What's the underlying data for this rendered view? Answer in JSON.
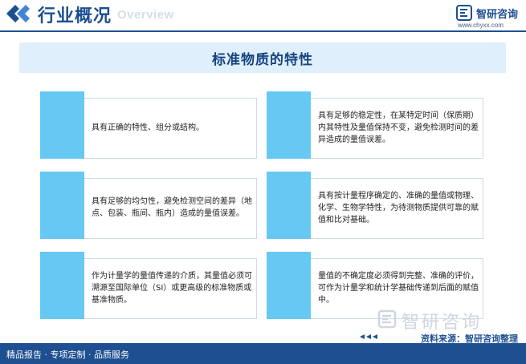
{
  "header": {
    "title": "行业概况",
    "subtitle": "Overview",
    "brand_name": "智研咨询",
    "brand_url": "www.chyxx.com"
  },
  "main": {
    "title": "标准物质的特性",
    "cards": [
      {
        "text": "具有正确的特性、组分或结构。"
      },
      {
        "text": "具有足够的稳定性，在某特定时间（保质期）内其特性及量值保持不变，避免检测时间的差异造成的量值误差。"
      },
      {
        "text": "具有足够的均匀性，避免检测空间的差异（地点、包装、瓶间、瓶内）造成的量值误差。"
      },
      {
        "text": "具有按计量程序确定的、准确的量值或物理、化学、生物学特性，为待测物质提供可靠的赋值和比对基础。"
      },
      {
        "text": "作为计量学的量值传递的介质，其量值必须可溯源至国际单位（SI）或更高级的标准物质或基准物质。"
      },
      {
        "text": "量值的不确定度必须得到完整、准确的评价，可作为计量学和统计学基础传递到后面的赋值中。"
      }
    ]
  },
  "watermark": {
    "text": "智研咨询"
  },
  "source": {
    "text": "资料来源：智研咨询整理"
  },
  "footer": {
    "text": "精品报告 · 专项定制 · 品质服务"
  },
  "colors": {
    "primary": "#1d4f91",
    "accent": "#66c9f3",
    "band": "#dfeffb"
  }
}
